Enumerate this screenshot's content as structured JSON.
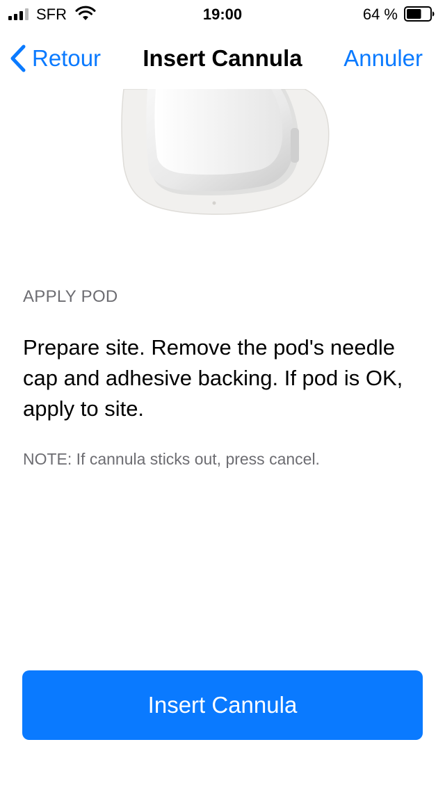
{
  "status_bar": {
    "carrier": "SFR",
    "time": "19:00",
    "battery_percent": "64 %",
    "battery_level": 0.64,
    "signal_bars_active": 3,
    "signal_bars_total": 4
  },
  "nav": {
    "back_label": "Retour",
    "title": "Insert Cannula",
    "cancel_label": "Annuler"
  },
  "content": {
    "section_header": "APPLY POD",
    "instructions": "Prepare site. Remove the pod's needle cap and adhesive backing. If pod is OK, apply to site.",
    "note": "NOTE: If cannula sticks out, press cancel."
  },
  "actions": {
    "primary_label": "Insert Cannula"
  },
  "colors": {
    "accent": "#0a7aff",
    "secondary_text": "#6d6d72",
    "background": "#ffffff"
  },
  "icons": {
    "back": "chevron-left-icon",
    "wifi": "wifi-icon",
    "battery": "battery-icon",
    "signal": "signal-icon"
  }
}
